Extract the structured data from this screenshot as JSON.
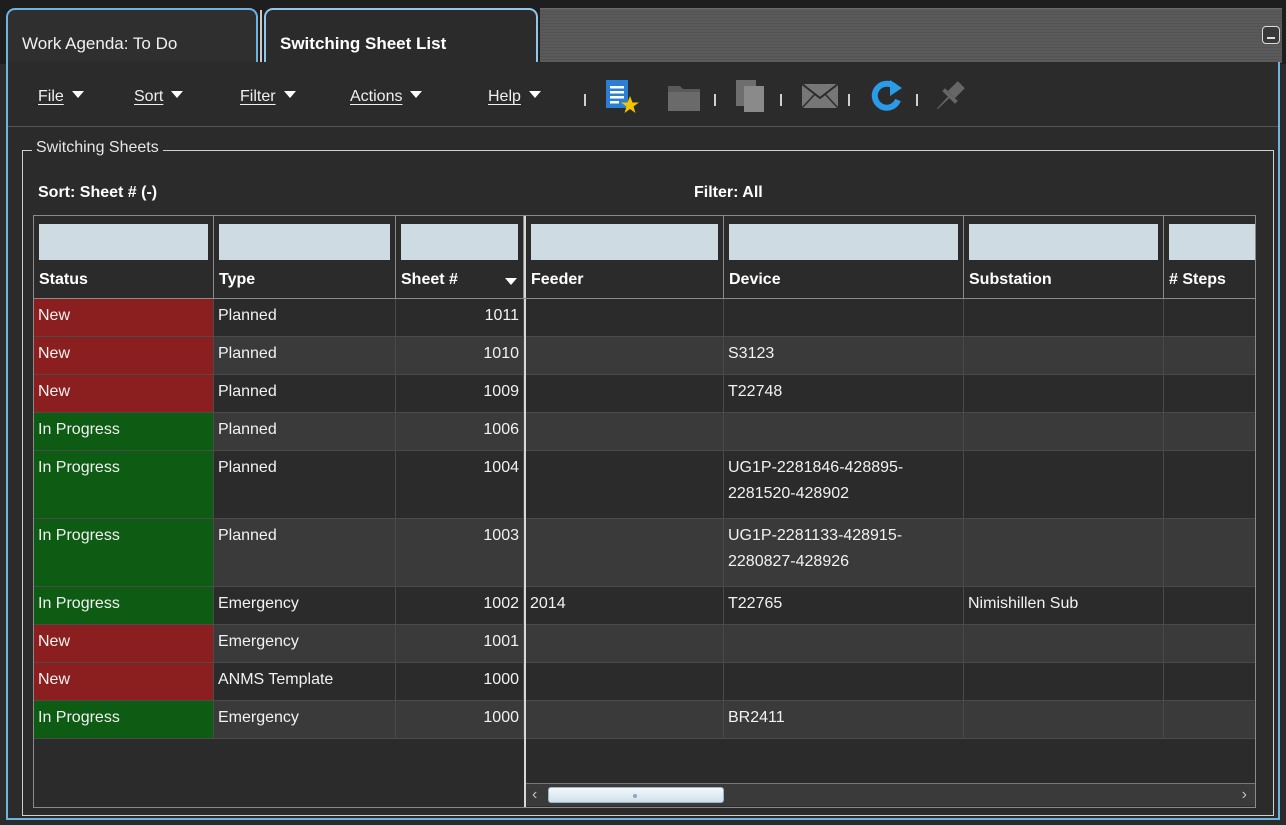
{
  "tabs": [
    {
      "label": "Work Agenda: To Do",
      "active": false
    },
    {
      "label": "Switching Sheet List",
      "active": true
    }
  ],
  "menus": [
    {
      "label": "File"
    },
    {
      "label": "Sort"
    },
    {
      "label": "Filter"
    },
    {
      "label": "Actions"
    },
    {
      "label": "Help"
    }
  ],
  "toolbar_icons": [
    "new-sheet-icon",
    "open-folder-icon",
    "copy-icon",
    "email-icon",
    "refresh-icon",
    "pin-icon"
  ],
  "group_title": "Switching Sheets",
  "sort_label": "Sort: Sheet # (-)",
  "filter_label": "Filter: All",
  "columns": [
    {
      "label": "Status"
    },
    {
      "label": "Type"
    },
    {
      "label": "Sheet #",
      "sorted": "desc"
    },
    {
      "label": "Feeder"
    },
    {
      "label": "Device"
    },
    {
      "label": "Substation"
    },
    {
      "label": "# Steps"
    }
  ],
  "rows": [
    {
      "status": "New",
      "type": "Planned",
      "sheet": "1011",
      "feeder": "",
      "device": "",
      "substation": "",
      "steps": ""
    },
    {
      "status": "New",
      "type": "Planned",
      "sheet": "1010",
      "feeder": "",
      "device": "S3123",
      "substation": "",
      "steps": ""
    },
    {
      "status": "New",
      "type": "Planned",
      "sheet": "1009",
      "feeder": "",
      "device": "T22748",
      "substation": "",
      "steps": ""
    },
    {
      "status": "In Progress",
      "type": "Planned",
      "sheet": "1006",
      "feeder": "",
      "device": "",
      "substation": "",
      "steps": ""
    },
    {
      "status": "In Progress",
      "type": "Planned",
      "sheet": "1004",
      "feeder": "",
      "device": "UG1P-2281846-428895-\n2281520-428902",
      "substation": "",
      "steps": ""
    },
    {
      "status": "In Progress",
      "type": "Planned",
      "sheet": "1003",
      "feeder": "",
      "device": "UG1P-2281133-428915-\n2280827-428926",
      "substation": "",
      "steps": ""
    },
    {
      "status": "In Progress",
      "type": "Emergency",
      "sheet": "1002",
      "feeder": "2014",
      "device": "T22765",
      "substation": "Nimishillen Sub",
      "steps": ""
    },
    {
      "status": "New",
      "type": "Emergency",
      "sheet": "1001",
      "feeder": "",
      "device": "",
      "substation": "",
      "steps": ""
    },
    {
      "status": "New",
      "type": "ANMS Template",
      "sheet": "1000",
      "feeder": "",
      "device": "",
      "substation": "",
      "steps": ""
    },
    {
      "status": "In Progress",
      "type": "Emergency",
      "sheet": "1000",
      "feeder": "",
      "device": "BR2411",
      "substation": "",
      "steps": ""
    }
  ],
  "colors": {
    "status_new": "#8b1f1f",
    "status_in_progress": "#0e5c14",
    "tab_border": "#6fb3e0",
    "accent_icon": "#2a7fd4"
  }
}
